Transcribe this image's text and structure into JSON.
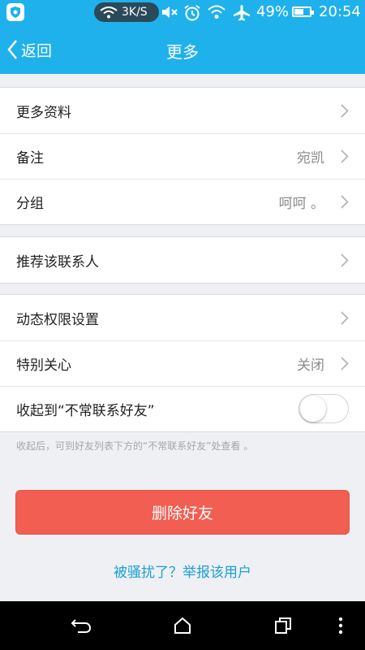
{
  "status_bar": {
    "net_speed": "3K/S",
    "battery_percent": "49%",
    "time": "20:54",
    "icons": [
      "shield-icon",
      "wifi-icon",
      "mute-icon",
      "alarm-icon",
      "wifi-signal-icon",
      "airplane-icon",
      "battery-icon"
    ]
  },
  "header": {
    "back_label": "返回",
    "title": "更多"
  },
  "groups": [
    {
      "rows": [
        {
          "label": "更多资料",
          "value": ""
        },
        {
          "label": "备注",
          "value": "宛凯"
        },
        {
          "label": "分组",
          "value": "呵呵 。"
        }
      ]
    },
    {
      "rows": [
        {
          "label": "推荐该联系人",
          "value": ""
        }
      ]
    },
    {
      "rows": [
        {
          "label": "动态权限设置",
          "value": ""
        },
        {
          "label": "特别关心",
          "value": "关闭"
        },
        {
          "label": "收起到“不常联系好友”",
          "value": "",
          "toggle": false
        }
      ]
    }
  ],
  "hint": "收起后，可到好友列表下方的“不常联系好友”处查看 。",
  "delete_button": "删除好友",
  "report_link": "被骚扰了？举报该用户",
  "colors": {
    "primary": "#1fb1ec",
    "danger": "#f25e51",
    "link": "#1a9fd6"
  }
}
